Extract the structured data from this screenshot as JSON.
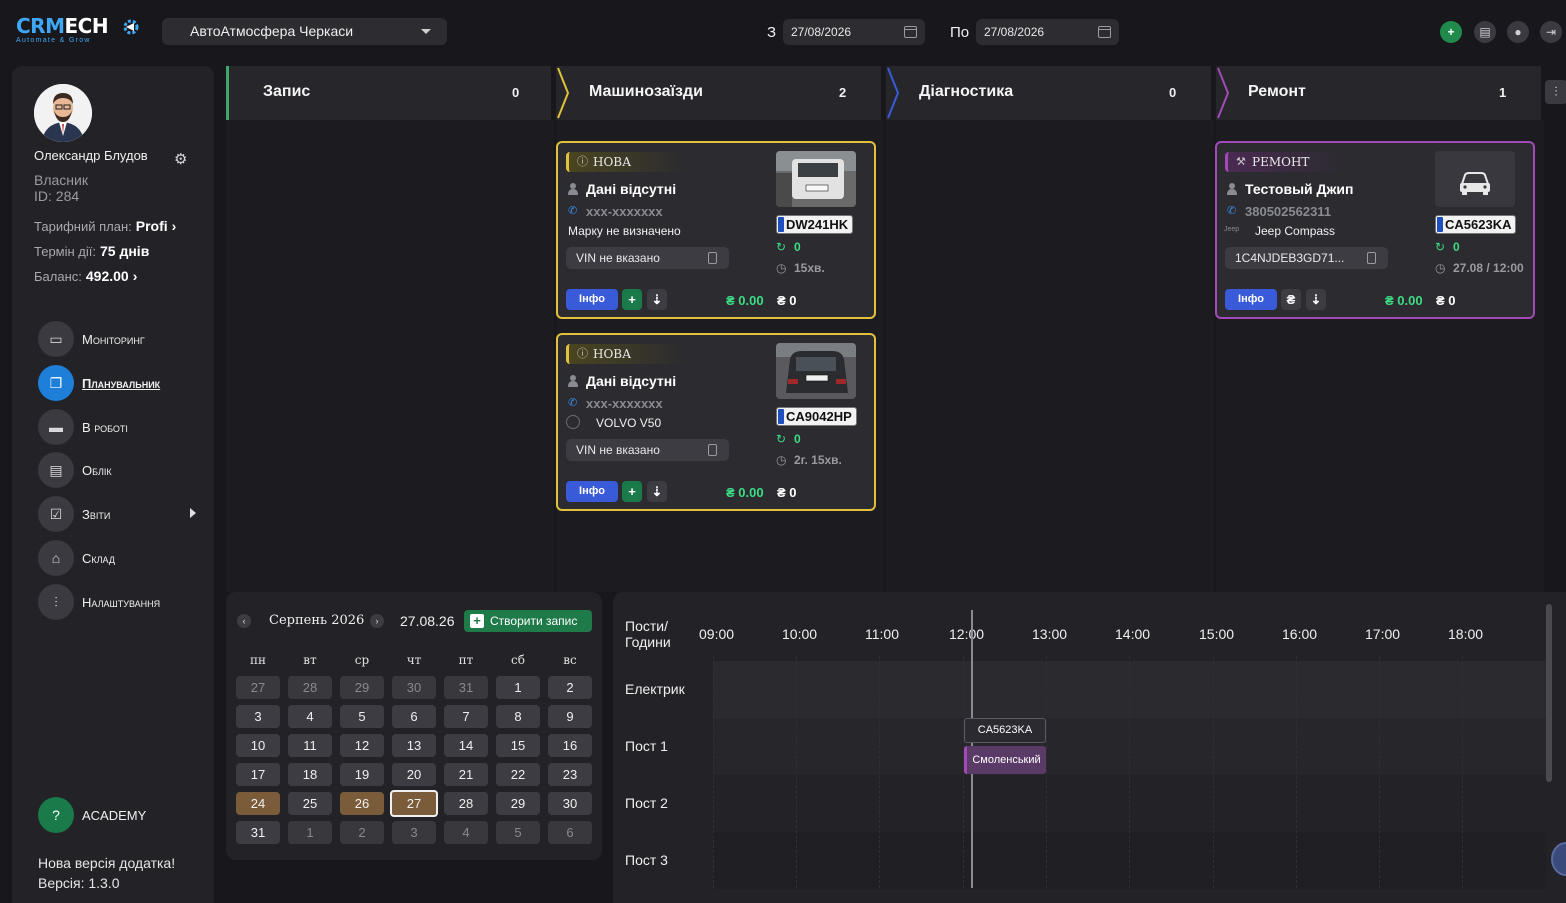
{
  "header": {
    "logo_text_a": "CRM",
    "logo_text_b": "ECH",
    "logo_tagline": "Automate & Grow",
    "branch": "АвтоАтмосфера Черкаси",
    "date_from_label": "З",
    "date_from": "27/08/2026",
    "date_to_label": "По",
    "date_to": "27/08/2026",
    "buttons": [
      {
        "icon": "plus-icon",
        "glyph": "+"
      },
      {
        "icon": "archive-icon",
        "glyph": "▤"
      },
      {
        "icon": "bell-icon",
        "glyph": "●"
      },
      {
        "icon": "logout-icon",
        "glyph": "⇥"
      }
    ]
  },
  "sidebar": {
    "user_name": "Олександр Блудов",
    "role": "Власник",
    "user_id": "ID: 284",
    "tariff_label": "Тарифний план:",
    "tariff_value": "Profi",
    "term_label": "Термін дії:",
    "term_value": "75 днів",
    "balance_label": "Баланс:",
    "balance_value": "492.00",
    "nav": [
      {
        "label": "Моніторинг",
        "icon": "video-icon",
        "glyph": "▭"
      },
      {
        "label": "Планувальник",
        "icon": "planner-icon",
        "glyph": "❐"
      },
      {
        "label": "В роботі",
        "icon": "car-icon",
        "glyph": "▬"
      },
      {
        "label": "Облік",
        "icon": "document-icon",
        "glyph": "▤"
      },
      {
        "label": "Звіти",
        "icon": "report-icon",
        "glyph": "☑"
      },
      {
        "label": "Склад",
        "icon": "warehouse-icon",
        "glyph": "⌂"
      },
      {
        "label": "Налаштування",
        "icon": "sliders-icon",
        "glyph": "⫶"
      }
    ],
    "academy": "ACADEMY",
    "version_line1": "Нова версія додатка!",
    "version_line2": "Версія: 1.3.0"
  },
  "stages": [
    {
      "title": "Запис",
      "count": "0",
      "color": "#3ea86a"
    },
    {
      "title": "Машинозаїзди",
      "count": "2",
      "color": "#e0c33a"
    },
    {
      "title": "Діагностика",
      "count": "0",
      "color": "#3a5bd9"
    },
    {
      "title": "Ремонт",
      "count": "1",
      "color": "#a24ab8"
    }
  ],
  "cards": [
    {
      "status": "НОВА",
      "name": "Дані відсутні",
      "phone": "xxx-xxxxxxx",
      "car": "Марку не визначено",
      "vin": "VIN не вказано",
      "plate": "DW241HK",
      "counter": "0",
      "time": "15хв.",
      "info": "Інфо",
      "sum_paid": "₴ 0.00",
      "sum_due": "₴ 0"
    },
    {
      "status": "НОВА",
      "name": "Дані відсутні",
      "phone": "xxx-xxxxxxx",
      "car": "VOLVO V50",
      "vin": "VIN не вказано",
      "plate": "CA9042HP",
      "counter": "0",
      "time": "2г. 15хв.",
      "info": "Інфо",
      "sum_paid": "₴ 0.00",
      "sum_due": "₴ 0"
    },
    {
      "status": "РЕМОНТ",
      "name": "Тестовый Джип",
      "phone": "380502562311",
      "brand": "Jeep",
      "car": "Jeep Compass",
      "vin": "1C4NJDEB3GD71...",
      "plate": "CA5623KA",
      "counter": "0",
      "time": "27.08 / 12:00",
      "info": "Інфо",
      "currency_btn": "₴",
      "sum_paid": "₴ 0.00",
      "sum_due": "₴ 0"
    }
  ],
  "calendar": {
    "month": "Серпень 2026",
    "selected": "27.08.26",
    "create_label": "Створити запис",
    "weekdays": [
      "пн",
      "вт",
      "ср",
      "чт",
      "пт",
      "сб",
      "вс"
    ],
    "weeks": [
      [
        "27",
        "28",
        "29",
        "30",
        "31",
        "1",
        "2"
      ],
      [
        "3",
        "4",
        "5",
        "6",
        "7",
        "8",
        "9"
      ],
      [
        "10",
        "11",
        "12",
        "13",
        "14",
        "15",
        "16"
      ],
      [
        "17",
        "18",
        "19",
        "20",
        "21",
        "22",
        "23"
      ],
      [
        "24",
        "25",
        "26",
        "27",
        "28",
        "29",
        "30"
      ],
      [
        "31",
        "1",
        "2",
        "3",
        "4",
        "5",
        "6"
      ]
    ]
  },
  "schedule": {
    "corner_line1": "Пости/",
    "corner_line2": "Години",
    "hours": [
      "09:00",
      "10:00",
      "11:00",
      "12:00",
      "13:00",
      "14:00",
      "15:00",
      "16:00",
      "17:00",
      "18:00"
    ],
    "posts": [
      "Електрик",
      "Пост 1",
      "Пост 2",
      "Пост 3"
    ],
    "event_plate": "CA5623KA",
    "event_name": "Смоленський"
  }
}
